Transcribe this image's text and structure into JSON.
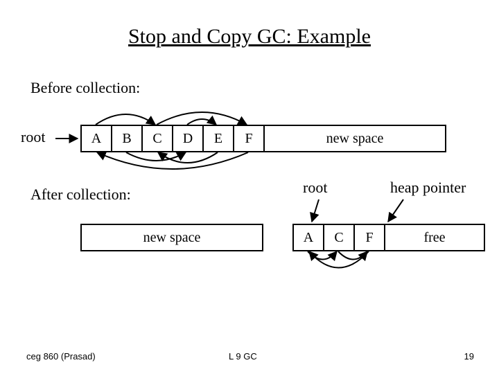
{
  "title": "Stop and Copy GC: Example",
  "before_label": "Before collection:",
  "after_label": "After collection:",
  "root_label": "root",
  "newspace_label": "new space",
  "heap_pointer_label": "heap pointer",
  "free_label": "free",
  "heap_before": {
    "cells": [
      "A",
      "B",
      "C",
      "D",
      "E",
      "F"
    ]
  },
  "heap_after_right": {
    "cells": [
      "A",
      "C",
      "F"
    ]
  },
  "footer": {
    "left": "ceg 860 (Prasad)",
    "mid": "L 9 GC",
    "right": "19"
  }
}
